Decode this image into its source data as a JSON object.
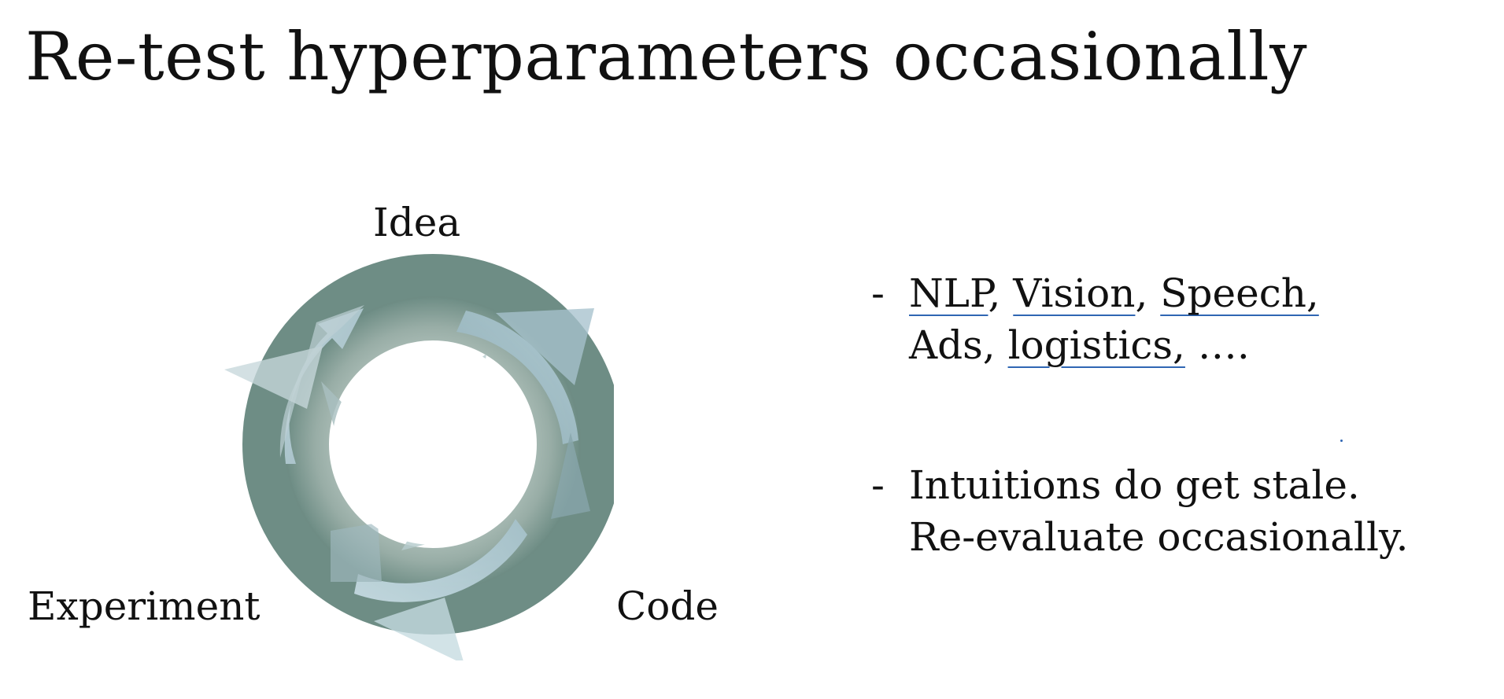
{
  "title": "Re-test hyperparameters occasionally",
  "cycle": {
    "labels": {
      "idea": "Idea",
      "code": "Code",
      "experiment": "Experiment"
    },
    "colors": {
      "ring_dark": "#6e8d85",
      "ring_light": "#aebfb8",
      "arrow_light": "#b9d3de",
      "arrow_mid": "#a8c4cc"
    }
  },
  "bullets": [
    {
      "dash": "-",
      "line1": [
        {
          "text": "NLP",
          "underlined": true
        },
        {
          "text": ", ",
          "underlined": false
        },
        {
          "text": "Vision",
          "underlined": true
        },
        {
          "text": ", ",
          "underlined": false
        },
        {
          "text": "Speech,",
          "underlined": true
        }
      ],
      "line2": [
        {
          "text": "Ads, ",
          "underlined": false
        },
        {
          "text": "logistics,",
          "underlined": true
        },
        {
          "text": " ….",
          "underlined": false
        }
      ]
    },
    {
      "dash": "-",
      "line1": [
        {
          "text": "Intuitions do get stale.",
          "underlined": false
        }
      ],
      "line2": [
        {
          "text": "Re-evaluate occasionally.",
          "underlined": false
        }
      ]
    }
  ],
  "annotation_color": "#2f66b3"
}
